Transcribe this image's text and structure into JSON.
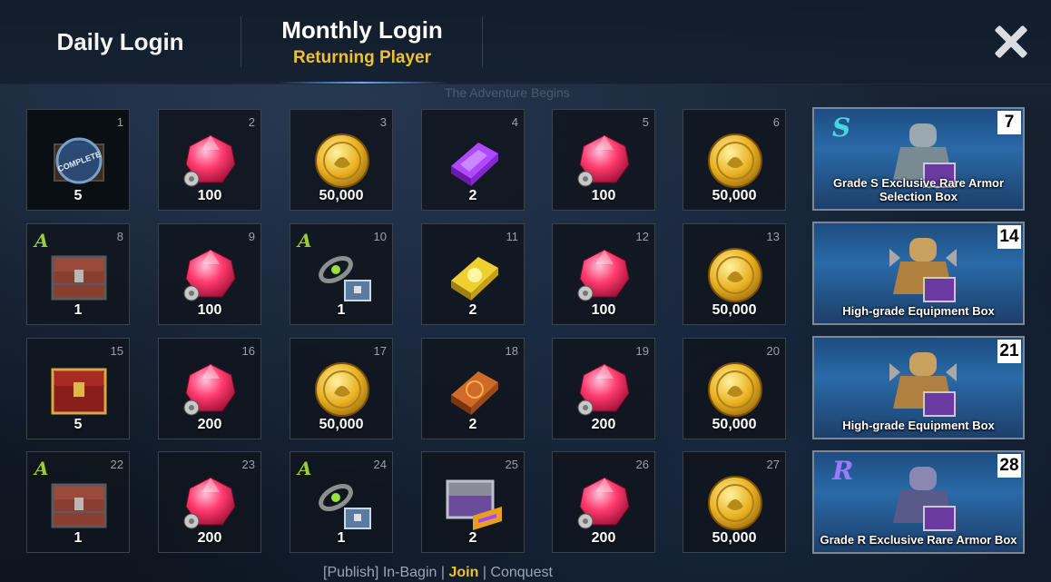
{
  "tabs": {
    "daily": "Daily Login",
    "monthly": "Monthly Login",
    "monthly_sub": "Returning Player"
  },
  "bg_text": {
    "adventure": "The Adventure Begins",
    "bottom_left": "[Publish] In-Bagin",
    "bottom_join": "Join",
    "bottom_right": "Conquest"
  },
  "colors": {
    "accent_gold": "#f0c030",
    "grade_a": "#9ccc3c",
    "grade_s": "#4ad4e0",
    "grade_r": "#9a7aff"
  },
  "rewards": [
    {
      "day": "1",
      "qty": "5",
      "icon": "complete-chest-icon",
      "grade": "",
      "done": true,
      "status": "COMPLETE"
    },
    {
      "day": "2",
      "qty": "100",
      "icon": "red-gem-icon",
      "grade": ""
    },
    {
      "day": "3",
      "qty": "50,000",
      "icon": "gold-coin-icon",
      "grade": ""
    },
    {
      "day": "4",
      "qty": "2",
      "icon": "purple-ingot-icon",
      "grade": ""
    },
    {
      "day": "5",
      "qty": "100",
      "icon": "red-gem-icon",
      "grade": ""
    },
    {
      "day": "6",
      "qty": "50,000",
      "icon": "gold-coin-icon",
      "grade": ""
    },
    {
      "day": "8",
      "qty": "1",
      "icon": "wooden-chest-icon",
      "grade": "A"
    },
    {
      "day": "9",
      "qty": "100",
      "icon": "red-gem-icon",
      "grade": ""
    },
    {
      "day": "10",
      "qty": "1",
      "icon": "accessory-chest-icon",
      "grade": "A"
    },
    {
      "day": "11",
      "qty": "2",
      "icon": "gold-ingot-icon",
      "grade": ""
    },
    {
      "day": "12",
      "qty": "100",
      "icon": "red-gem-icon",
      "grade": ""
    },
    {
      "day": "13",
      "qty": "50,000",
      "icon": "gold-coin-icon",
      "grade": ""
    },
    {
      "day": "15",
      "qty": "5",
      "icon": "red-chest-icon",
      "grade": ""
    },
    {
      "day": "16",
      "qty": "200",
      "icon": "red-gem-icon",
      "grade": ""
    },
    {
      "day": "17",
      "qty": "50,000",
      "icon": "gold-coin-icon",
      "grade": ""
    },
    {
      "day": "18",
      "qty": "2",
      "icon": "copper-ingot-icon",
      "grade": ""
    },
    {
      "day": "19",
      "qty": "200",
      "icon": "red-gem-icon",
      "grade": ""
    },
    {
      "day": "20",
      "qty": "50,000",
      "icon": "gold-coin-icon",
      "grade": ""
    },
    {
      "day": "22",
      "qty": "1",
      "icon": "wooden-chest-icon",
      "grade": "A"
    },
    {
      "day": "23",
      "qty": "200",
      "icon": "red-gem-icon",
      "grade": ""
    },
    {
      "day": "24",
      "qty": "1",
      "icon": "accessory-chest-icon",
      "grade": "A"
    },
    {
      "day": "25",
      "qty": "2",
      "icon": "silver-chest-icon",
      "grade": ""
    },
    {
      "day": "26",
      "qty": "200",
      "icon": "red-gem-icon",
      "grade": ""
    },
    {
      "day": "27",
      "qty": "50,000",
      "icon": "gold-coin-icon",
      "grade": ""
    }
  ],
  "big_rewards": [
    {
      "day": "7",
      "title": "Grade S Exclusive Rare Armor Selection Box",
      "grade": "S",
      "icon": "armor-box-icon"
    },
    {
      "day": "14",
      "title": "High-grade Equipment Box",
      "grade": "",
      "icon": "gold-armor-box-icon"
    },
    {
      "day": "21",
      "title": "High-grade Equipment Box",
      "grade": "",
      "icon": "gold-armor-box-icon"
    },
    {
      "day": "28",
      "title": "Grade R Exclusive Rare Armor Box",
      "grade": "R",
      "icon": "purple-armor-box-icon"
    }
  ]
}
